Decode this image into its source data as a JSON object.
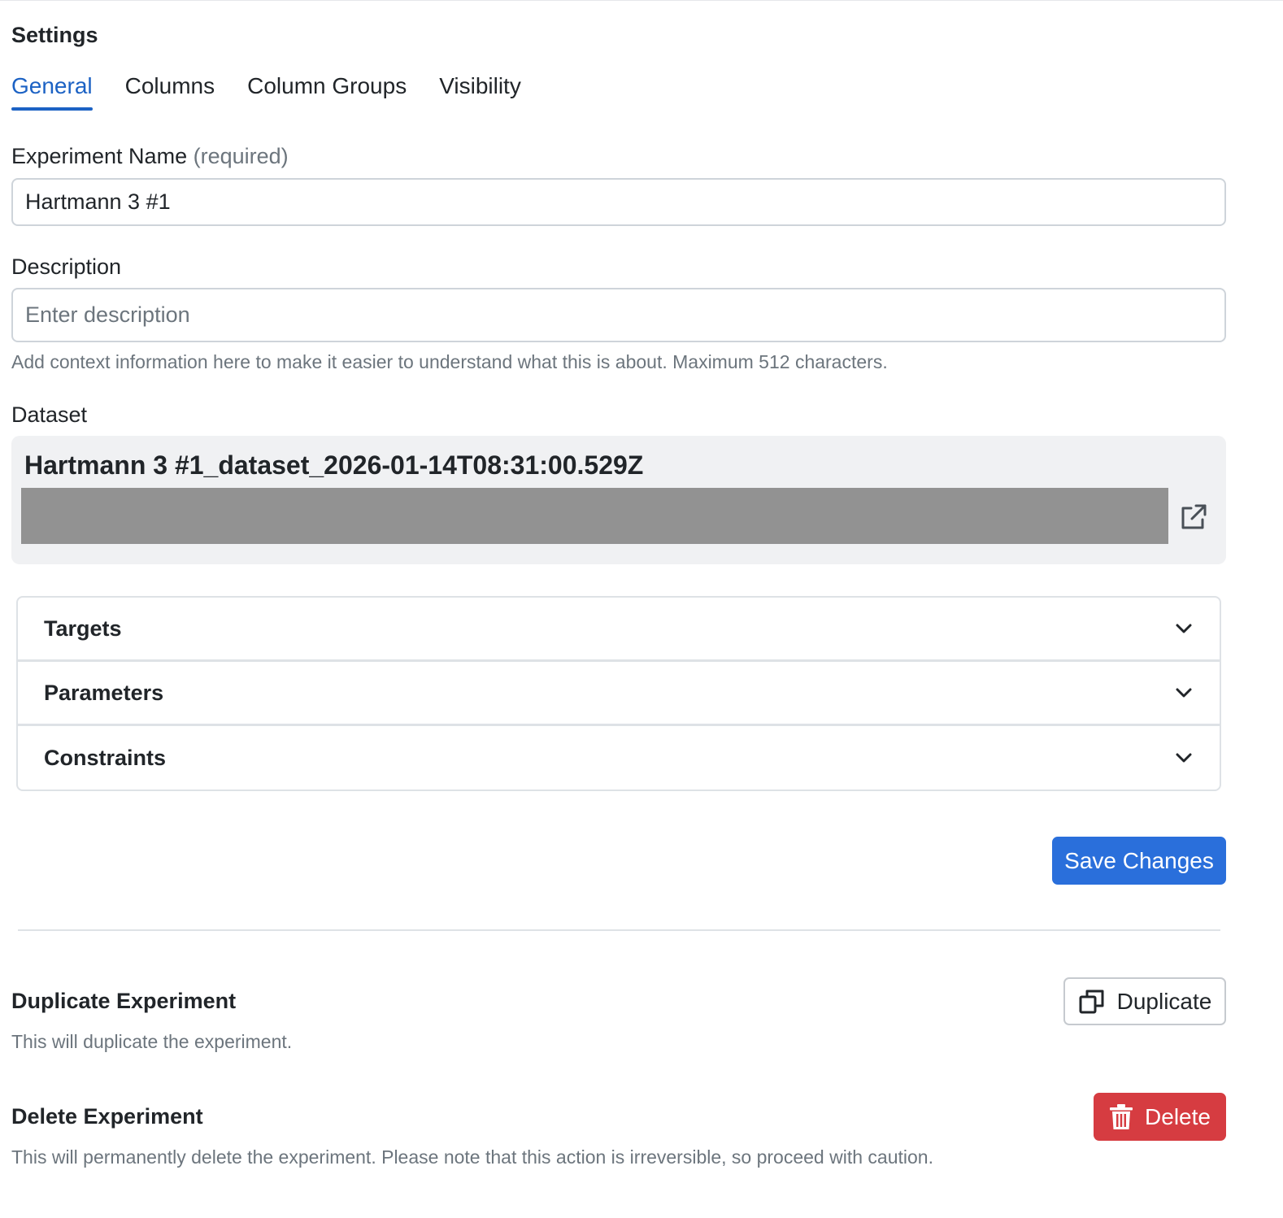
{
  "page": {
    "title": "Settings"
  },
  "tabs": [
    {
      "label": "General",
      "active": true
    },
    {
      "label": "Columns",
      "active": false
    },
    {
      "label": "Column Groups",
      "active": false
    },
    {
      "label": "Visibility",
      "active": false
    }
  ],
  "form": {
    "name_label": "Experiment Name",
    "name_required": "(required)",
    "name_value": "Hartmann 3 #1",
    "description_label": "Description",
    "description_placeholder": "Enter description",
    "description_value": "",
    "description_help": "Add context information here to make it easier to understand what this is about. Maximum 512 characters."
  },
  "dataset": {
    "label": "Dataset",
    "name": "Hartmann 3 #1_dataset_2026-01-14T08:31:00.529Z",
    "open_icon": "external-link-icon"
  },
  "accordion": [
    {
      "label": "Targets",
      "icon": "chevron-down-icon"
    },
    {
      "label": "Parameters",
      "icon": "chevron-down-icon"
    },
    {
      "label": "Constraints",
      "icon": "chevron-down-icon"
    }
  ],
  "actions": {
    "save_label": "Save Changes"
  },
  "duplicate": {
    "title": "Duplicate Experiment",
    "description": "This will duplicate the experiment.",
    "button_label": "Duplicate",
    "icon": "copy-icon"
  },
  "delete": {
    "title": "Delete Experiment",
    "description": "This will permanently delete the experiment. Please note that this action is irreversible, so proceed with caution.",
    "button_label": "Delete",
    "icon": "trash-icon"
  },
  "colors": {
    "primary": "#2a6fdb",
    "tab_active": "#1c62c4",
    "danger": "#d63c41",
    "muted_text": "#6c757d",
    "dataset_bg": "#f0f1f3",
    "dataset_bar": "#929292"
  }
}
